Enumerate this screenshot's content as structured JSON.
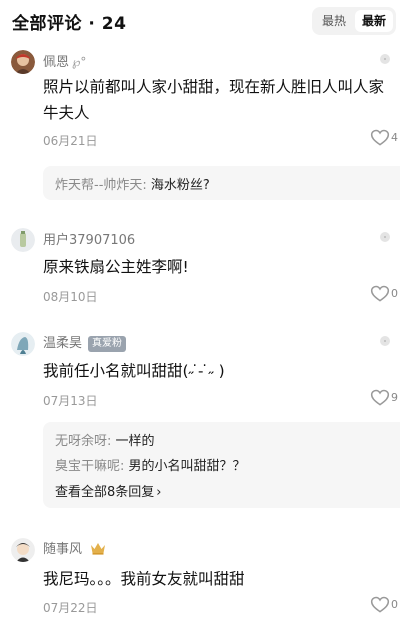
{
  "header": {
    "title": "全部评论 · 24",
    "sort_hot": "最热",
    "sort_new": "最新",
    "active_sort": "最新"
  },
  "comments": [
    {
      "user": "佩恩",
      "name_deco": "℘°",
      "text_line1": "照片以前都叫人家小甜甜，现在新人胜旧人叫人家",
      "text_line2": "牛夫人",
      "date": "06月21日",
      "likes": "4",
      "replies": [
        {
          "user": "炸天帮--帅炸天",
          "sep": ": ",
          "text": "海水粉丝?"
        }
      ]
    },
    {
      "user": "用户37907106",
      "text_line1": "原来铁扇公主姓李啊!",
      "date": "08月10日",
      "likes": "0"
    },
    {
      "user": "温柔昊",
      "badge": "真爱粉",
      "text_line1": "我前任小名就叫甜甜(˶ ̇ ̵ ̇˶ )",
      "date": "07月13日",
      "likes": "9",
      "replies": [
        {
          "user": "无呀余呀",
          "sep": ": ",
          "text": "一样的"
        },
        {
          "user": "臭宝干嘛呢",
          "sep": ": ",
          "text": "男的小名叫甜甜？？"
        }
      ],
      "view_all": "查看全部8条回复",
      "view_all_chevron": "›"
    },
    {
      "user": "随事风",
      "text_line1": "我尼玛。。。我前女友就叫甜甜",
      "date": "07月22日",
      "likes": "0"
    }
  ],
  "colors": {
    "text_primary": "#111111",
    "text_secondary": "#777777",
    "date_gray": "#999999",
    "reply_bg": "#f6f6f6",
    "badge_bg": "#9aa3ae",
    "crown": "#e3b04b"
  },
  "icons": {
    "like": "heart-outline-icon",
    "more": "more-dot-icon"
  }
}
